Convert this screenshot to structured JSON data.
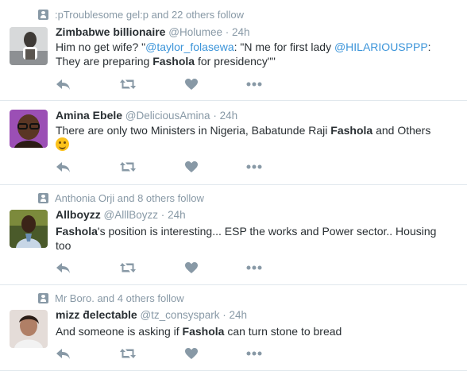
{
  "colors": {
    "link": "#3b94d9",
    "muted": "#8899a6",
    "text": "#292f33",
    "divider": "#e1e8ed"
  },
  "tweets": [
    {
      "context": ":pTroublesome gel:p and 22 others follow",
      "name": "Zimbabwe billionaire",
      "handle": "@Holumee",
      "time": "24h",
      "text": {
        "a": "Him no get wife? \"",
        "mention1": "@taylor_folasewa",
        "b": ": \"N me for first lady ",
        "mention2": "@HILARIOUSPPP",
        "c": ":",
        "d": "They are preparing ",
        "bold": "Fashola",
        "e": " for presidency\"\""
      }
    },
    {
      "context": "",
      "name": "Amina Ebele",
      "handle": "@DeliciousAmina",
      "time": "24h",
      "text": {
        "a": "There are only two Ministers in Nigeria, Babatunde Raji ",
        "bold": "Fashola",
        "b": " and Others",
        "emoji": "smiling-face-emoji"
      }
    },
    {
      "context": "Anthonia Orji and 8 others follow",
      "name": "Allboyzz",
      "handle": "@AlllBoyzz",
      "time": "24h",
      "text": {
        "bold": "Fashola",
        "a": "'s position is interesting... ESP the works and Power sector.. Housing",
        "b": "too"
      }
    },
    {
      "context": "Mr Boro. and 4 others follow",
      "name": "mizz ƌelectable",
      "handle": "@tz_consyspark",
      "time": "24h",
      "text": {
        "a": "And someone is asking if ",
        "bold": "Fashola",
        "b": " can turn stone to bread"
      }
    }
  ],
  "separator": "·"
}
